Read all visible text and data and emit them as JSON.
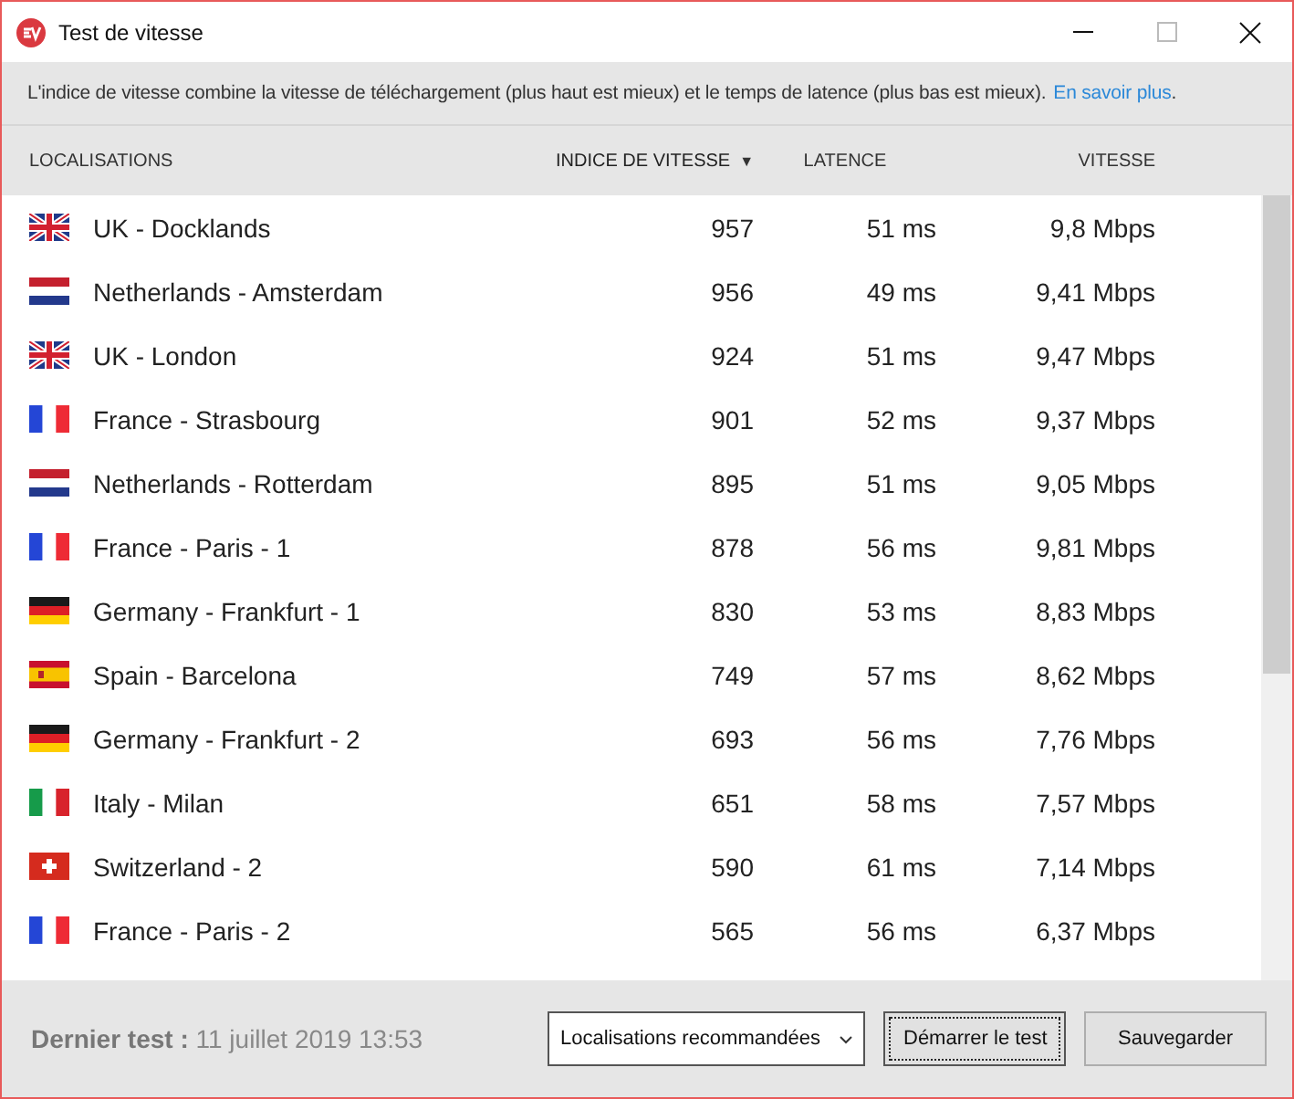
{
  "window": {
    "title": "Test de vitesse"
  },
  "info": {
    "text": "L'indice de vitesse combine la vitesse de téléchargement (plus haut est mieux) et le temps de latence (plus bas est mieux).",
    "link": "En savoir plus",
    "after": "."
  },
  "table": {
    "columns": [
      {
        "label": "LOCALISATIONS",
        "sorted": false
      },
      {
        "label": "INDICE DE VITESSE",
        "sorted": true,
        "sort_icon": "▼"
      },
      {
        "label": "LATENCE",
        "sorted": false
      },
      {
        "label": "VITESSE",
        "sorted": false
      }
    ],
    "rows": [
      {
        "kind": "uk",
        "location": "UK - Docklands",
        "score": "957",
        "latency": "51 ms",
        "speed": "9,8 Mbps"
      },
      {
        "kind": "nl",
        "location": "Netherlands - Amsterdam",
        "score": "956",
        "latency": "49 ms",
        "speed": "9,41 Mbps"
      },
      {
        "kind": "uk",
        "location": "UK - London",
        "score": "924",
        "latency": "51 ms",
        "speed": "9,47 Mbps"
      },
      {
        "kind": "fr",
        "location": "France - Strasbourg",
        "score": "901",
        "latency": "52 ms",
        "speed": "9,37 Mbps"
      },
      {
        "kind": "nl",
        "location": "Netherlands - Rotterdam",
        "score": "895",
        "latency": "51 ms",
        "speed": "9,05 Mbps"
      },
      {
        "kind": "fr",
        "location": "France - Paris - 1",
        "score": "878",
        "latency": "56 ms",
        "speed": "9,81 Mbps"
      },
      {
        "kind": "de",
        "location": "Germany - Frankfurt - 1",
        "score": "830",
        "latency": "53 ms",
        "speed": "8,83 Mbps"
      },
      {
        "kind": "es",
        "location": "Spain - Barcelona",
        "score": "749",
        "latency": "57 ms",
        "speed": "8,62 Mbps"
      },
      {
        "kind": "de",
        "location": "Germany - Frankfurt - 2",
        "score": "693",
        "latency": "56 ms",
        "speed": "7,76 Mbps"
      },
      {
        "kind": "it",
        "location": "Italy - Milan",
        "score": "651",
        "latency": "58 ms",
        "speed": "7,57 Mbps"
      },
      {
        "kind": "ch",
        "location": "Switzerland - 2",
        "score": "590",
        "latency": "61 ms",
        "speed": "7,14 Mbps"
      },
      {
        "kind": "fr",
        "location": "France - Paris - 2",
        "score": "565",
        "latency": "56 ms",
        "speed": "6,37 Mbps"
      }
    ]
  },
  "footer": {
    "last_test": "**Dernier test :** 11 juillet 2019 13:53",
    "dropdown": {
      "value": "Localisations recommandées"
    },
    "buttons": [
      {
        "label": "Démarrer le test",
        "focused": true
      },
      {
        "label": "Sauvegarder",
        "focused": false
      }
    ]
  }
}
